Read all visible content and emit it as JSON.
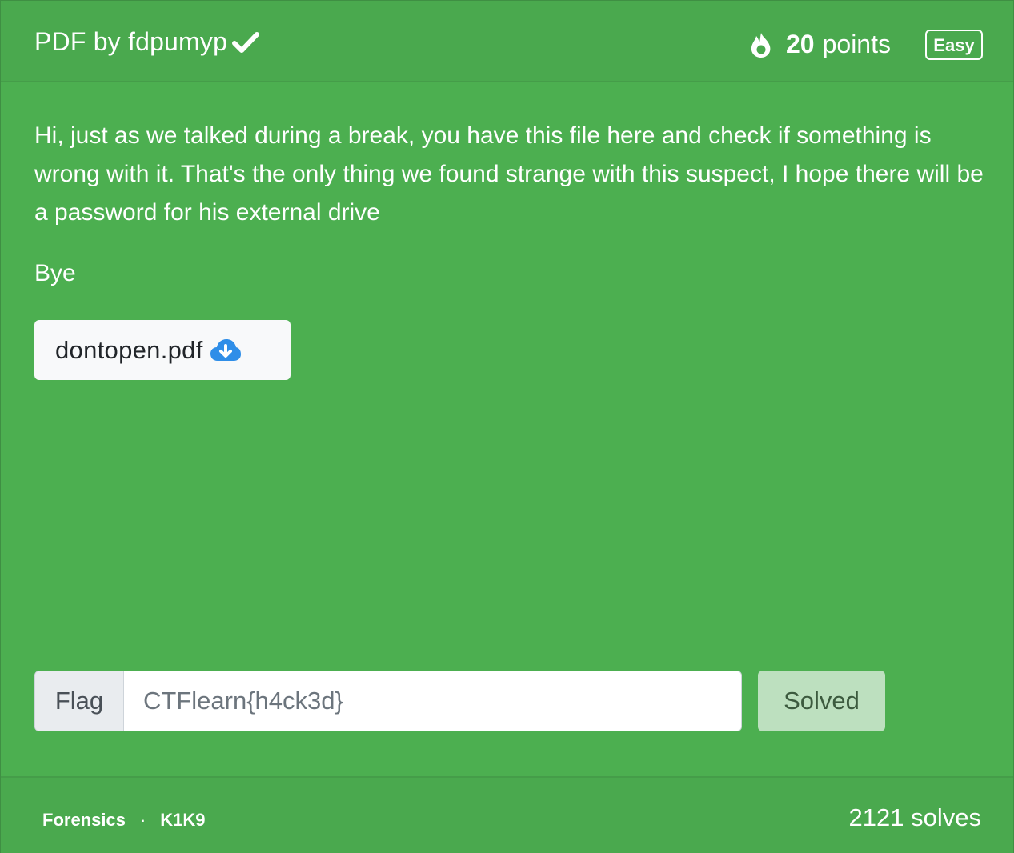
{
  "header": {
    "title": "PDF by fdpumyp",
    "verified_icon": "check-icon",
    "points_value": "20",
    "points_label": "points",
    "points_icon": "fire-icon",
    "difficulty": "Easy"
  },
  "body": {
    "description": "Hi, just as we talked during a break, you have this file here and check if something is wrong with it. That's the only thing we found strange with this suspect, I hope there will be a password for his external drive",
    "closing": "Bye",
    "attachment": {
      "filename": "dontopen.pdf",
      "icon": "cloud-download-icon"
    }
  },
  "flag_form": {
    "label": "Flag",
    "placeholder": "CTFlearn{h4ck3d}",
    "value": "",
    "submit_label": "Solved"
  },
  "footer": {
    "category": "Forensics",
    "separator": "·",
    "author": "K1K9",
    "solves": "2121 solves"
  },
  "colors": {
    "card_background": "#4caf50",
    "header_background": "#4aa94e",
    "solved_button": "#bde0bf",
    "download_icon": "#2f8ee8"
  }
}
